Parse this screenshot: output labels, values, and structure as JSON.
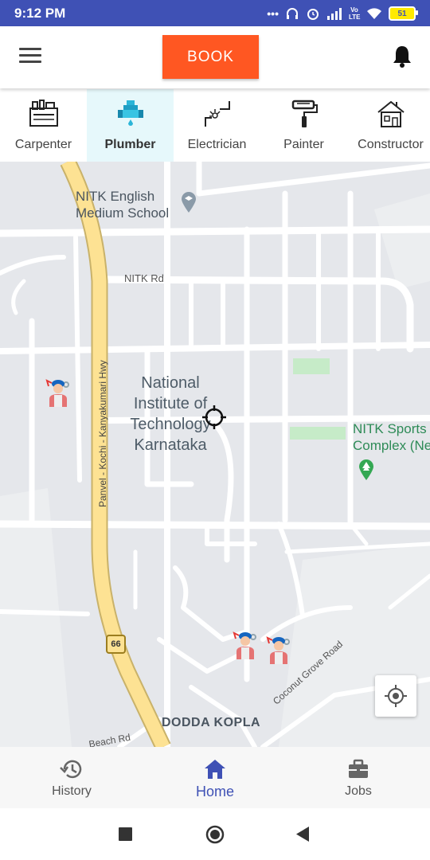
{
  "status_bar": {
    "time": "9:12 PM",
    "battery": "51",
    "network": "Vo LTE"
  },
  "header": {
    "book_label": "BOOK"
  },
  "categories": [
    {
      "label": "Carpenter",
      "icon": "carpenter-toolbox-icon",
      "active": false
    },
    {
      "label": "Plumber",
      "icon": "plumber-pipe-icon",
      "active": true
    },
    {
      "label": "Electrician",
      "icon": "electrician-wire-icon",
      "active": false
    },
    {
      "label": "Painter",
      "icon": "paint-roller-icon",
      "active": false
    },
    {
      "label": "Constructor",
      "icon": "house-construction-icon",
      "active": false
    }
  ],
  "map": {
    "campus": "National Institute of Technology Karnataka",
    "school": "NITK English Medium School",
    "road_nitk": "NITK Rd",
    "sports": "NITK Sports Complex (Ne",
    "highway": "Panvel - Kochi - Kanyakumari Hwy",
    "highway_number": "66",
    "coconut_road": "Coconut Grove Road",
    "beach_road": "Beach Rd",
    "locality": "DODDA KOPLA"
  },
  "bottom_nav": [
    {
      "label": "History",
      "icon": "history-icon",
      "active": false
    },
    {
      "label": "Home",
      "icon": "home-icon",
      "active": true
    },
    {
      "label": "Jobs",
      "icon": "briefcase-icon",
      "active": false
    }
  ],
  "colors": {
    "primary": "#3f51b5",
    "book": "#ff5722",
    "active_tab_bg": "#e6f8fb",
    "road_highway": "#fde293",
    "map_bg": "#e5e7eb"
  }
}
